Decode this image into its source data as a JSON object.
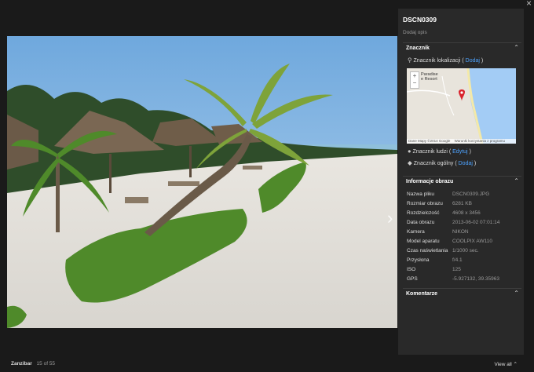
{
  "close_glyph": "×",
  "photo": {
    "next_glyph": "›"
  },
  "panel": {
    "title": "DSCN0309",
    "description_placeholder": "Dodaj opis",
    "tags_section": {
      "title": "Znacznik",
      "location": {
        "label": "Znacznik lokalizacji",
        "open_paren": "(",
        "link": "Dodaj",
        "close_paren": ")"
      },
      "map": {
        "zoom_in": "+",
        "zoom_out": "−",
        "place_label_line1": "Paradise",
        "place_label_line2": "e Resort",
        "attribution": "Dane Mapy ©2014 Google",
        "terms": "Warunki korzystania z programu"
      },
      "people": {
        "label": "Znacznik ludzi",
        "open_paren": "(",
        "link": "Edytuj",
        "close_paren": ")"
      },
      "general": {
        "label": "Znacznik ogólny",
        "open_paren": "(",
        "link": "Dodaj",
        "close_paren": ")"
      }
    },
    "info_section": {
      "title": "Informacje obrazu",
      "rows": [
        {
          "key": "Nazwa pliku",
          "value": "DSCN0309.JPG"
        },
        {
          "key": "Rozmiar obrazu",
          "value": "6281 KB"
        },
        {
          "key": "Rozdzielczość",
          "value": "4608 x 3456"
        },
        {
          "key": "Data obrazu",
          "value": "2013-06-02 07:01:14"
        },
        {
          "key": "Kamera",
          "value": "NIKON"
        },
        {
          "key": "Model aparatu",
          "value": "COOLPIX AW110"
        },
        {
          "key": "Czas naświetlania",
          "value": "1/1000 sec."
        },
        {
          "key": "Przysłona",
          "value": "f/4.1"
        },
        {
          "key": "ISO",
          "value": "125"
        },
        {
          "key": "GPS",
          "value": "-5.927132, 39.35963"
        }
      ]
    },
    "comments_section": {
      "title": "Komentarze"
    }
  },
  "footer": {
    "album": "Zanzibar",
    "counter": "15 of 55",
    "view_all": "View all"
  },
  "colors": {
    "link": "#4da3ff",
    "panel_bg": "#292929",
    "page_bg": "#1a1a1a",
    "pin": "#d9232d"
  }
}
